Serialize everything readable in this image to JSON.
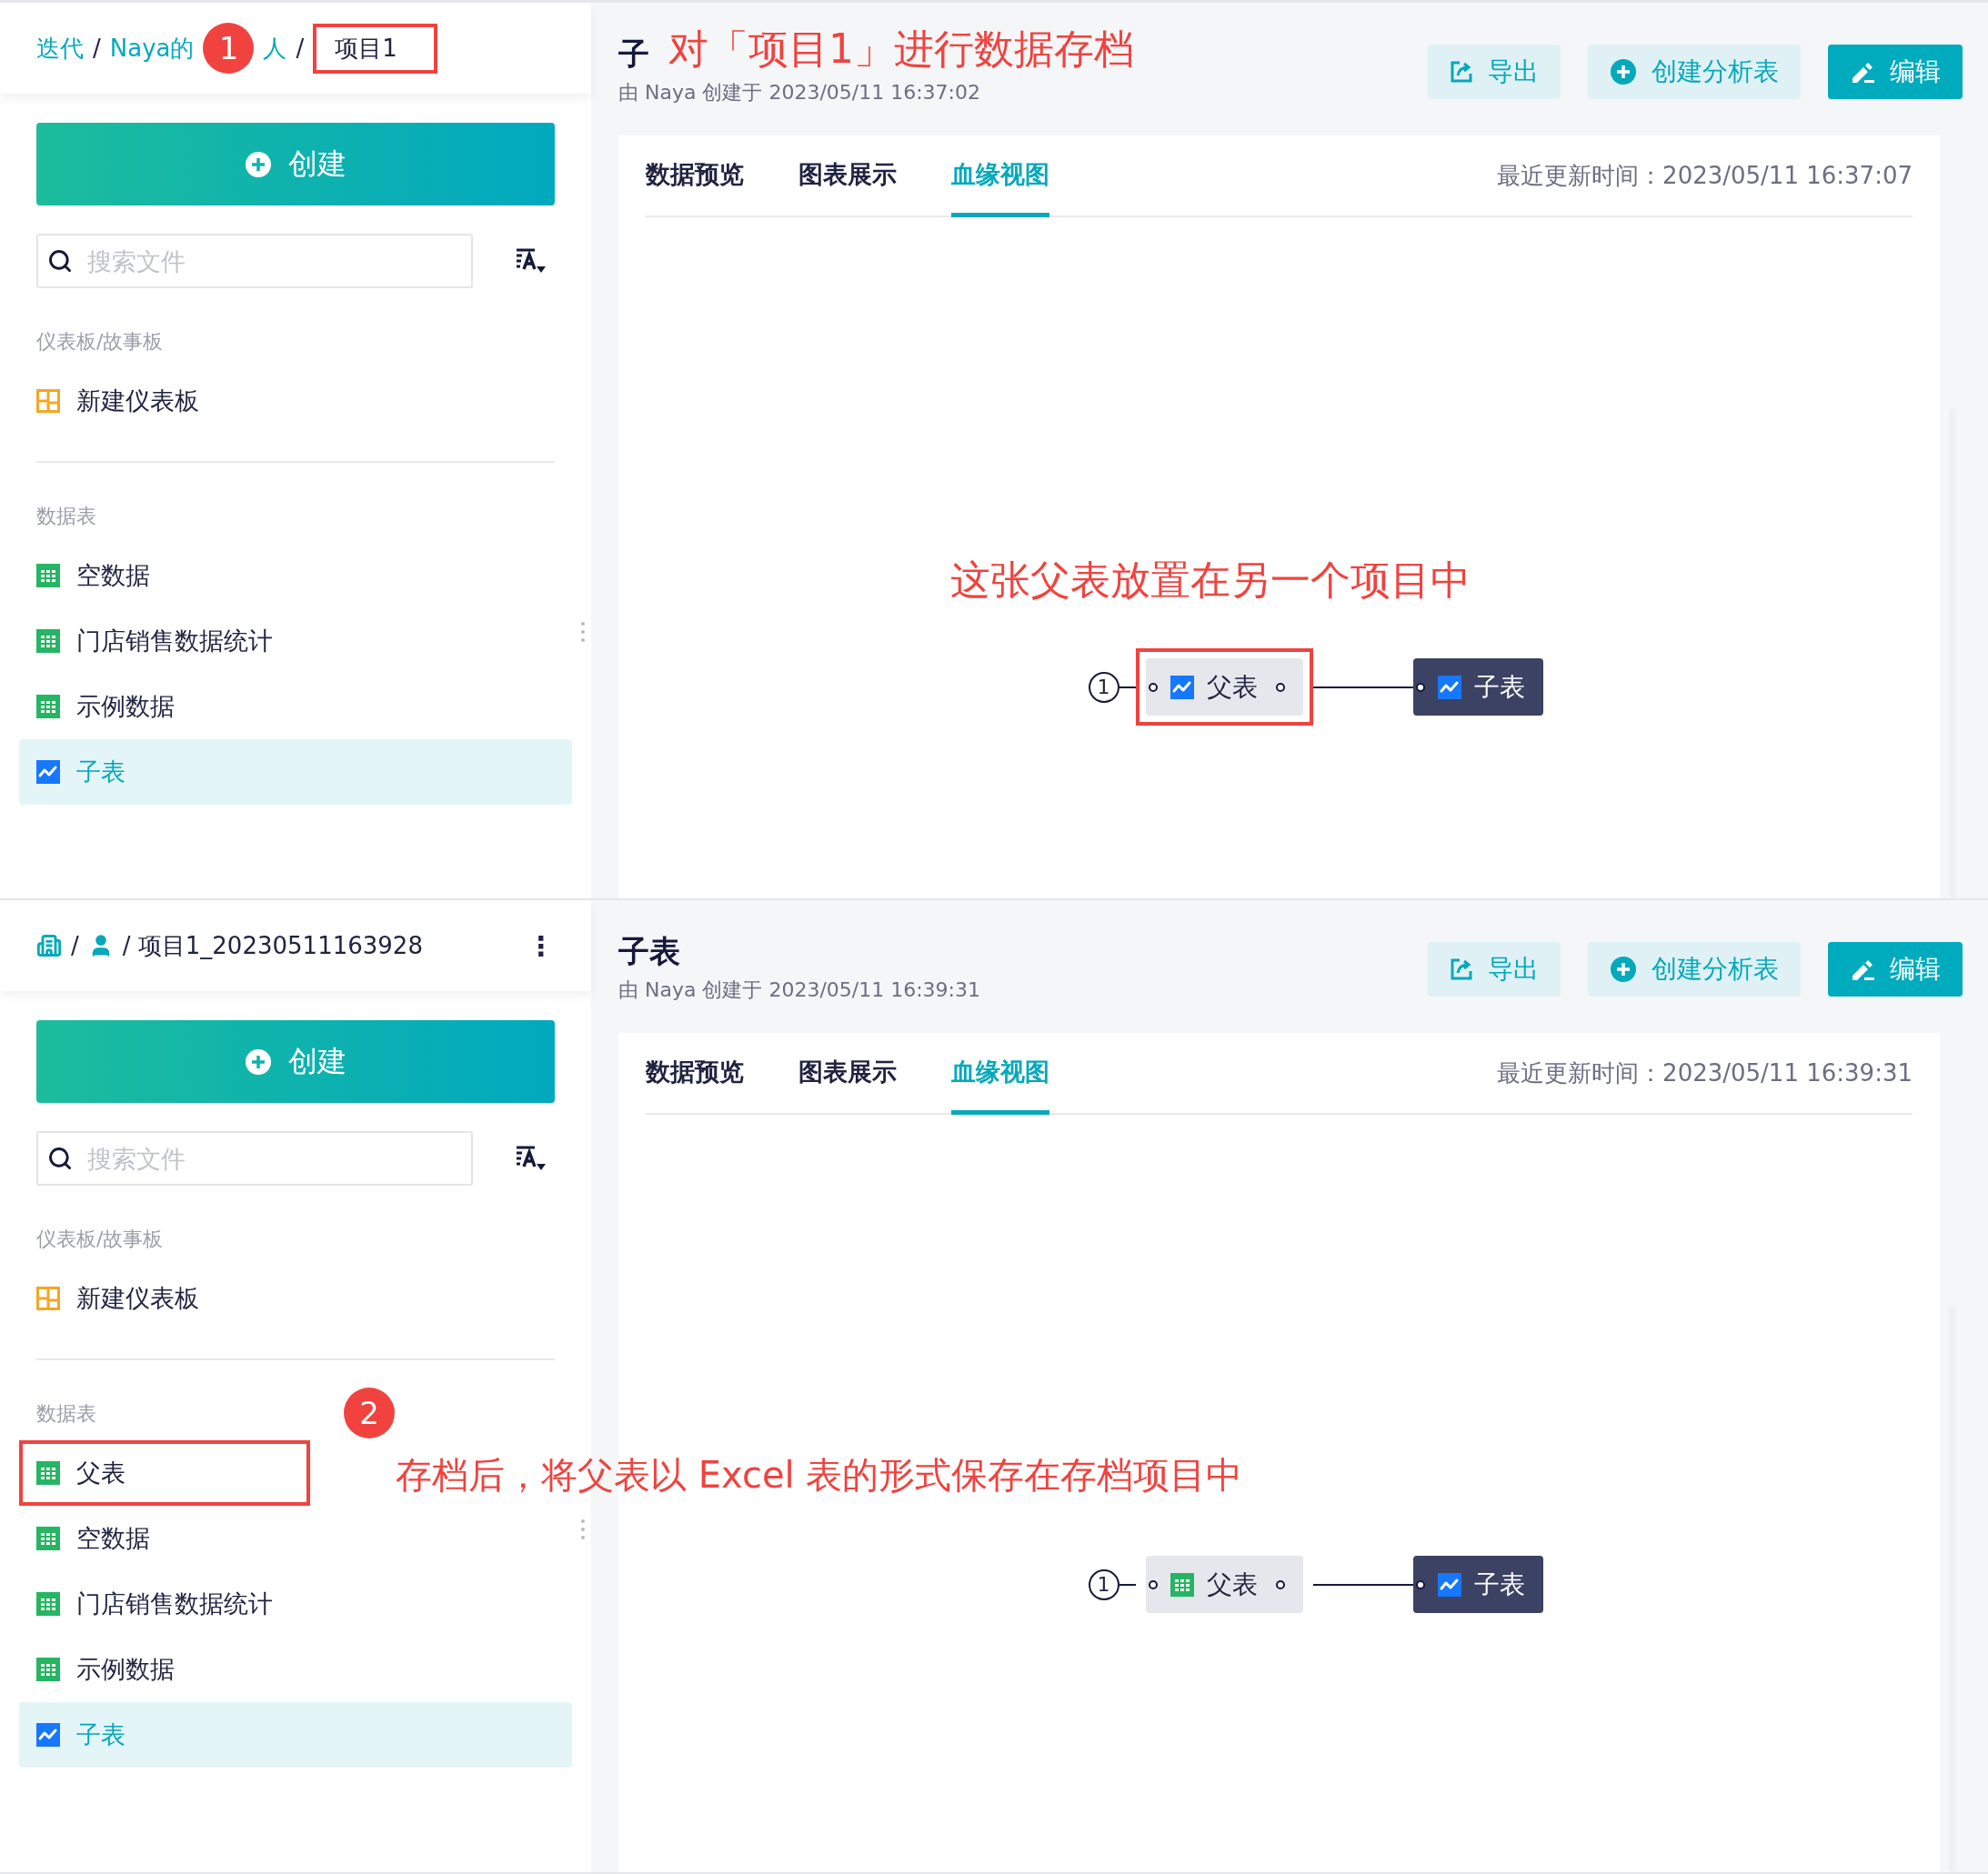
{
  "panels": [
    {
      "breadcrumb": [
        {
          "kind": "link",
          "text": "迭代"
        },
        {
          "kind": "sep",
          "text": "/"
        },
        {
          "kind": "link",
          "text": "Naya的"
        },
        {
          "kind": "step",
          "text": "1"
        },
        {
          "kind": "link",
          "text": "人"
        },
        {
          "kind": "sep",
          "text": "/"
        },
        {
          "kind": "current",
          "text": "项目1",
          "highlighted": true
        }
      ],
      "create_button": "创建",
      "search": {
        "placeholder": "搜索文件"
      },
      "sections": [
        {
          "label": "仪表板/故事板",
          "items": [
            {
              "text": "新建仪表板",
              "kind": "dashboard",
              "selected": false,
              "highlighted": false
            }
          ]
        },
        {
          "label": "数据表",
          "items": [
            {
              "text": "空数据",
              "kind": "table",
              "selected": false,
              "highlighted": false
            },
            {
              "text": "门店销售数据统计",
              "kind": "table",
              "selected": false,
              "highlighted": false
            },
            {
              "text": "示例数据",
              "kind": "table",
              "selected": false,
              "highlighted": false
            },
            {
              "text": "子表",
              "kind": "chart",
              "selected": true,
              "highlighted": false
            }
          ]
        }
      ],
      "title": "子",
      "subtitle": "由 Naya 创建于 2023/05/11 16:37:02",
      "buttons": [
        {
          "kind": "export",
          "label": "导出"
        },
        {
          "kind": "create",
          "label": "创建分析表"
        },
        {
          "kind": "edit",
          "label": "编辑"
        }
      ],
      "tabs": [
        {
          "label": "数据预览",
          "selected": false
        },
        {
          "label": "图表展示",
          "selected": false
        },
        {
          "label": "血缘视图",
          "selected": true
        }
      ],
      "updated": "最近更新时间：2023/05/11 16:37:07",
      "lineage": {
        "index": "1",
        "parent": {
          "label": "父表",
          "kind": "chart",
          "highlighted": true
        },
        "child": {
          "label": "子表",
          "kind": "chart"
        }
      },
      "annotations": [
        {
          "kind": "header-note",
          "text": "对「项目1」进行数据存档"
        },
        {
          "kind": "canvas-note",
          "text": "这张父表放置在另一个项目中"
        }
      ]
    },
    {
      "breadcrumb": [
        {
          "kind": "org"
        },
        {
          "kind": "sep",
          "text": "/"
        },
        {
          "kind": "user"
        },
        {
          "kind": "current",
          "text": "/ 项目1_20230511163928",
          "highlighted": false
        }
      ],
      "more_menu": "⋮",
      "create_button": "创建",
      "search": {
        "placeholder": "搜索文件"
      },
      "sections": [
        {
          "label": "仪表板/故事板",
          "items": [
            {
              "text": "新建仪表板",
              "kind": "dashboard",
              "selected": false,
              "highlighted": false
            }
          ]
        },
        {
          "label": "数据表",
          "items": [
            {
              "text": "父表",
              "kind": "table",
              "selected": false,
              "highlighted": true
            },
            {
              "text": "空数据",
              "kind": "table",
              "selected": false,
              "highlighted": false
            },
            {
              "text": "门店销售数据统计",
              "kind": "table",
              "selected": false,
              "highlighted": false
            },
            {
              "text": "示例数据",
              "kind": "table",
              "selected": false,
              "highlighted": false
            },
            {
              "text": "子表",
              "kind": "chart",
              "selected": true,
              "highlighted": false
            }
          ]
        }
      ],
      "title": "子表",
      "subtitle": "由 Naya 创建于 2023/05/11 16:39:31",
      "buttons": [
        {
          "kind": "export",
          "label": "导出"
        },
        {
          "kind": "create",
          "label": "创建分析表"
        },
        {
          "kind": "edit",
          "label": "编辑"
        }
      ],
      "tabs": [
        {
          "label": "数据预览",
          "selected": false
        },
        {
          "label": "图表展示",
          "selected": false
        },
        {
          "label": "血缘视图",
          "selected": true
        }
      ],
      "updated": "最近更新时间：2023/05/11 16:39:31",
      "lineage": {
        "index": "1",
        "parent": {
          "label": "父表",
          "kind": "table",
          "highlighted": false
        },
        "child": {
          "label": "子表",
          "kind": "chart"
        }
      },
      "annotations": [
        {
          "kind": "step",
          "text": "2"
        },
        {
          "kind": "side-note",
          "text": "存档后，将父表以 Excel 表的形式保存在存档项目中"
        }
      ]
    }
  ]
}
